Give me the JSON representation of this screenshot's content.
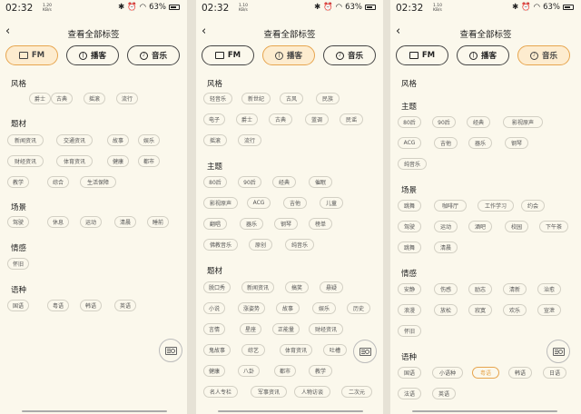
{
  "status": {
    "time": "02:32",
    "speed_value": "1.20",
    "speed_unit": "KB/s",
    "battery": "63%"
  },
  "page_title": "查看全部标签",
  "tabs": [
    "FM",
    "播客",
    "音乐"
  ],
  "panel1": {
    "speed_value": "1.20",
    "sections": {
      "style": {
        "title": "风格",
        "tags": [
          "爵士",
          "古典",
          "摇滚",
          "流行"
        ]
      },
      "topic": {
        "title": "题材",
        "tags": [
          "新闻资讯",
          "交通资讯",
          "故事",
          "娱乐",
          "财经资讯",
          "体育资讯",
          "健康",
          "都市",
          "教学",
          "综合",
          "生活保障"
        ]
      },
      "scene": {
        "title": "场景",
        "tags": [
          "驾驶",
          "休息",
          "运动",
          "清晨",
          "睡前"
        ]
      },
      "mood": {
        "title": "情感",
        "tags": [
          "怀旧"
        ]
      },
      "lang": {
        "title": "语种",
        "tags": [
          "国语",
          "粤语",
          "韩语",
          "英语"
        ]
      }
    }
  },
  "panel2": {
    "speed_value": "1.10",
    "sections": {
      "style": {
        "title": "风格",
        "tags": [
          "轻音乐",
          "新世纪",
          "古风",
          "民族",
          "电子",
          "爵士",
          "古典",
          "蓝调",
          "民谣",
          "摇滚",
          "流行"
        ]
      },
      "theme": {
        "title": "主题",
        "tags": [
          "80后",
          "90后",
          "经典",
          "催眠",
          "影视原声",
          "ACG",
          "吉他",
          "儿童",
          "翻唱",
          "器乐",
          "钢琴",
          "榜单",
          "佛教音乐",
          "原创",
          "纯音乐"
        ]
      },
      "topic": {
        "title": "题材",
        "tags": [
          "脱口秀",
          "新闻资讯",
          "搞笑",
          "悬疑",
          "小说",
          "涨姿势",
          "故事",
          "娱乐",
          "历史",
          "言情",
          "星座",
          "正能量",
          "财经资讯",
          "鬼故事",
          "综艺",
          "体育资讯",
          "吐槽",
          "健康",
          "八卦",
          "都市",
          "教学",
          "名人专栏",
          "军事资讯",
          "人物访谈",
          "二次元"
        ]
      }
    }
  },
  "panel3": {
    "speed_value": "1.10",
    "sections": {
      "style": {
        "title": "风格",
        "tags": []
      },
      "theme": {
        "title": "主题",
        "tags": [
          "80后",
          "90后",
          "经典",
          "影视原声",
          "ACG",
          "吉他",
          "器乐",
          "钢琴",
          "纯音乐"
        ]
      },
      "scene": {
        "title": "场景",
        "tags": [
          "跳舞",
          "咖啡厅",
          "工作学习",
          "约会",
          "驾驶",
          "运动",
          "酒吧",
          "校园",
          "下午茶",
          "跳舞",
          "清晨"
        ]
      },
      "mood": {
        "title": "情感",
        "tags": [
          "安静",
          "伤感",
          "励志",
          "清新",
          "治愈",
          "浪漫",
          "放松",
          "寂寞",
          "欢乐",
          "宣泄",
          "怀旧"
        ]
      },
      "lang": {
        "title": "语种",
        "tags": [
          "国语",
          "小语种",
          "粤语",
          "韩语",
          "日语",
          "法语",
          "英语"
        ],
        "selected": "粤语"
      }
    }
  },
  "colors": {
    "accent": "#e7a54e",
    "background": "#fbf8ec",
    "tab_active_bg": "#fdeccf"
  }
}
